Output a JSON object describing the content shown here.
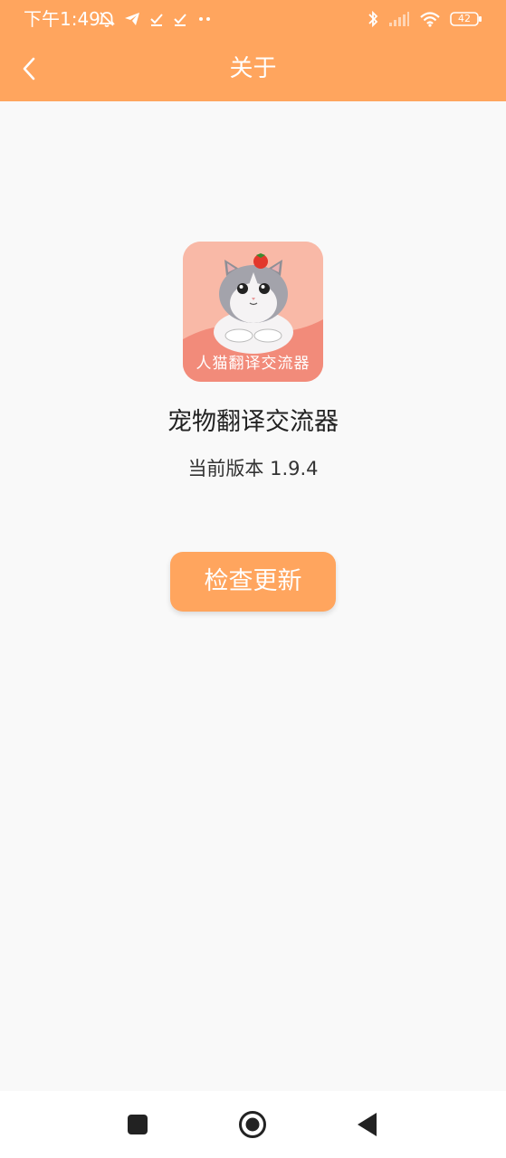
{
  "status_bar": {
    "time": "下午1:49",
    "battery_level": "42",
    "left_icons": [
      "alarm-off-icon",
      "telegram-icon",
      "check-icon",
      "check-icon",
      "more-dots-icon"
    ],
    "right_icons": [
      "bluetooth-icon",
      "signal-icon",
      "wifi-icon",
      "battery-icon"
    ]
  },
  "header": {
    "title": "关于",
    "back_icon": "chevron-left-icon",
    "background_color": "#ffa55e"
  },
  "app": {
    "icon_text": "人猫翻译交流器",
    "name": "宠物翻译交流器",
    "version_label": "当前版本 1.9.4"
  },
  "actions": {
    "check_update_label": "检查更新"
  },
  "navigation_bar": {
    "buttons": [
      "recents-square-icon",
      "home-circle-icon",
      "back-triangle-icon"
    ]
  }
}
